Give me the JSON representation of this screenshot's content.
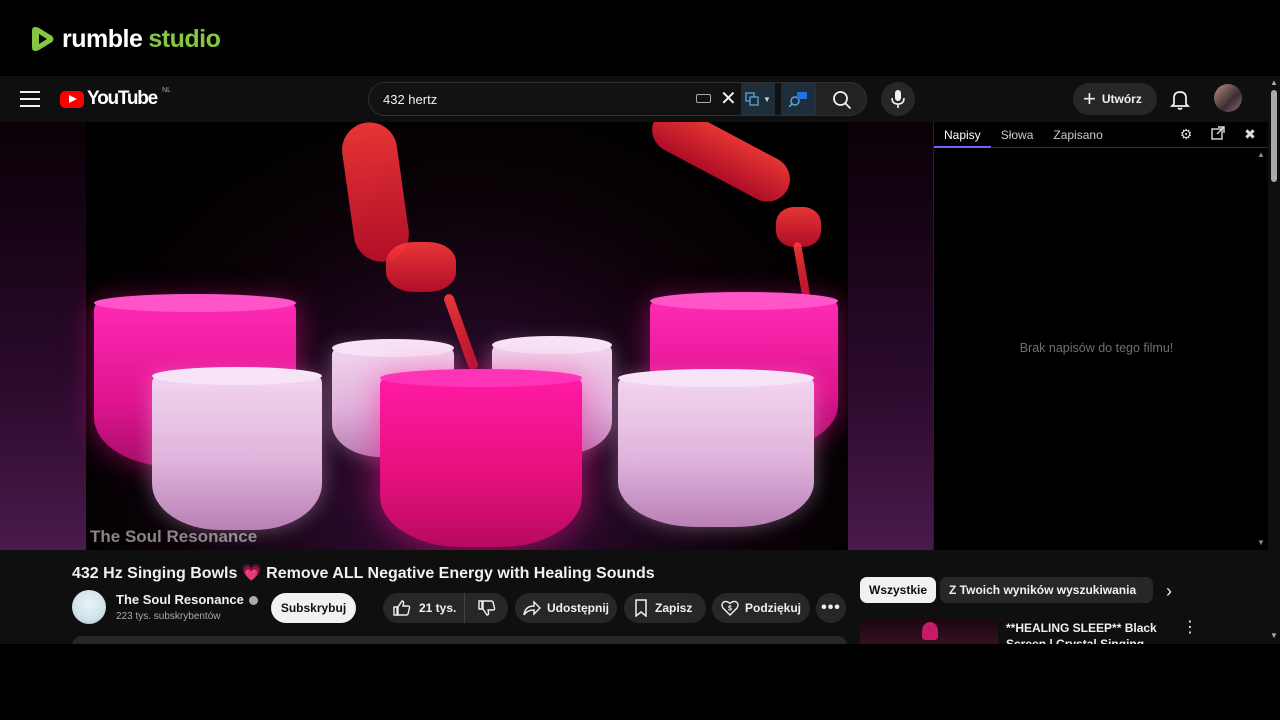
{
  "rumble": {
    "word1": "rumble",
    "word2": "studio"
  },
  "youtube": {
    "logo_text": "YouTube",
    "country_code": "NL",
    "search": {
      "value": "432 hertz"
    },
    "create_label": "Utwórz"
  },
  "video": {
    "watermark": "The Soul Resonance",
    "title_part1": "432 Hz Singing Bowls ",
    "title_emoji": "💗",
    "title_part2": " Remove ALL Negative Energy with Healing Sounds"
  },
  "captions_panel": {
    "tabs": [
      "Napisy",
      "Słowa",
      "Zapisano"
    ],
    "active_tab": "Napisy",
    "empty_message": "Brak napisów do tego filmu!"
  },
  "channel": {
    "name": "The Soul Resonance",
    "subscribers": "223 tys. subskrybentów",
    "subscribe_label": "Subskrybuj"
  },
  "actions": {
    "likes": "21 tys.",
    "share": "Udostępnij",
    "save": "Zapisz",
    "thanks": "Podziękuj",
    "more": "•••"
  },
  "chips": [
    "Wszystkie",
    "Z Twoich wyników wyszukiwania"
  ],
  "recommendation": {
    "title": "**HEALING SLEEP** Black Screen | Crystal Singing Bowls"
  },
  "colors": {
    "rumble_green": "#85c742",
    "youtube_red": "#ff0000",
    "background": "#0f0f0f",
    "active_tab_underline": "#7b5cff"
  }
}
